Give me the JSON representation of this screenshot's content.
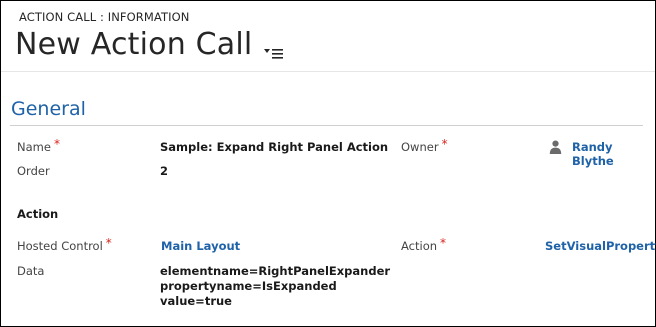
{
  "header": {
    "entity_label": "ACTION CALL : INFORMATION",
    "record_title": "New Action Call"
  },
  "section": {
    "title": "General"
  },
  "fields": {
    "name": {
      "label": "Name",
      "value": "Sample: Expand Right Panel Action",
      "required": true
    },
    "owner": {
      "label": "Owner",
      "value": "Randy Blythe",
      "required": true
    },
    "order": {
      "label": "Order",
      "value": "2"
    },
    "action_heading": "Action",
    "hosted_control": {
      "label": "Hosted Control",
      "value": "Main Layout",
      "required": true
    },
    "action": {
      "label": "Action",
      "value": "SetVisualProperty",
      "required": true
    },
    "data": {
      "label": "Data",
      "lines": [
        "elementname=RightPanelExpander",
        "propertyname=IsExpanded",
        "value=true"
      ]
    }
  },
  "icons": {
    "title_menu": "list-menu-icon",
    "owner": "person-icon"
  },
  "colors": {
    "link": "#1f62a8",
    "required": "#d9241e",
    "section_title": "#1f62a8"
  }
}
